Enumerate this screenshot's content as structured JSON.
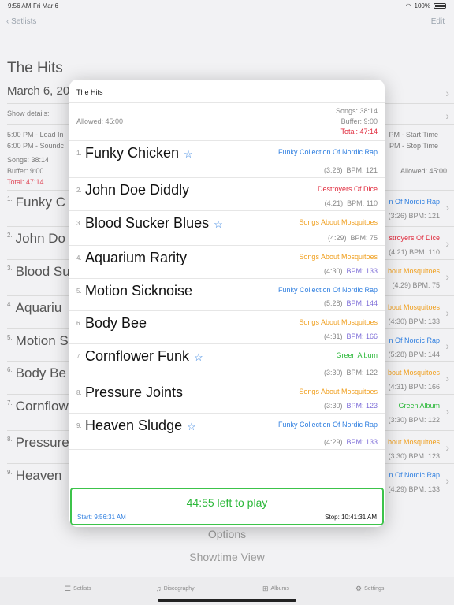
{
  "status": {
    "time": "9:56 AM",
    "date": "Fri Mar 6",
    "battery": "100%"
  },
  "background": {
    "nav": {
      "back": "Setlists",
      "edit": "Edit"
    },
    "title": "The Hits",
    "date": "March 6, 20",
    "show_details": "Show details:",
    "times": {
      "load_in": "5:00 PM - Load In",
      "soundcheck": "6:00 PM - Soundc",
      "start_time": "PM - Start Time",
      "stop_time": "PM - Stop Time"
    },
    "songs_label": "Songs:   38:14",
    "buffer_label": "Buffer:   9:00",
    "total_label": "Total:",
    "total_value": "47:14",
    "allowed": "Allowed:   45:00",
    "songs": [
      {
        "num": "1.",
        "name": "Funky C"
      },
      {
        "num": "2.",
        "name": "John Do"
      },
      {
        "num": "3.",
        "name": "Blood Su"
      },
      {
        "num": "4.",
        "name": "Aquariu"
      },
      {
        "num": "5.",
        "name": "Motion S"
      },
      {
        "num": "6.",
        "name": "Body Be"
      },
      {
        "num": "7.",
        "name": "Cornflow"
      },
      {
        "num": "8.",
        "name": "Pressure"
      },
      {
        "num": "9.",
        "name": "Heaven"
      }
    ],
    "right": [
      {
        "album": "n Of Nordic Rap",
        "album_color": "#2f7fe0",
        "meta": "(3:26)  BPM: 121"
      },
      {
        "album": "stroyers Of Dice",
        "album_color": "#e02a3c",
        "meta": "(4:21)  BPM: 110"
      },
      {
        "album": "bout Mosquitoes",
        "album_color": "#f0a020",
        "meta": "(4:29)  BPM: 75"
      },
      {
        "album": "bout Mosquitoes",
        "album_color": "#f0a020",
        "meta": "(4:30)  BPM: 133"
      },
      {
        "album": "n Of Nordic Rap",
        "album_color": "#2f7fe0",
        "meta": "(5:28)  BPM: 144"
      },
      {
        "album": "bout Mosquitoes",
        "album_color": "#f0a020",
        "meta": "(4:31)  BPM: 166"
      },
      {
        "album": "Green   Album",
        "album_color": "#2cb83a",
        "meta": "(3:30)  BPM: 122"
      },
      {
        "album": "bout Mosquitoes",
        "album_color": "#f0a020",
        "meta": "(3:30)  BPM: 123"
      },
      {
        "album": "n Of Nordic Rap",
        "album_color": "#2f7fe0",
        "meta": "(4:29)  BPM: 133"
      }
    ],
    "options": "Options",
    "showtime": "Showtime View"
  },
  "tabbar": [
    {
      "label": "Setlists",
      "icon": "list-icon"
    },
    {
      "label": "Discography",
      "icon": "music-icon"
    },
    {
      "label": "Albums",
      "icon": "albums-icon"
    },
    {
      "label": "Settings",
      "icon": "gear-icon"
    }
  ],
  "modal": {
    "title": "The Hits",
    "allowed": "Allowed:   45:00",
    "songs_stat": "Songs:   38:14",
    "buffer_stat": "Buffer:   9:00",
    "total_stat": "Total:   47:14",
    "songs": [
      {
        "num": "1.",
        "name": "Funky Chicken",
        "star": true,
        "album": "Funky Collection Of Nordic Rap",
        "album_color": "#2f7fe0",
        "duration": "(3:26)",
        "bpm": "BPM: 121",
        "bpm_color": "#888888"
      },
      {
        "num": "2.",
        "name": "John Doe Diddly",
        "star": false,
        "album": "Destroyers Of Dice",
        "album_color": "#e02a3c",
        "duration": "(4:21)",
        "bpm": "BPM: 110",
        "bpm_color": "#888888"
      },
      {
        "num": "3.",
        "name": "Blood Sucker Blues",
        "star": true,
        "album": "Songs About Mosquitoes",
        "album_color": "#f0a020",
        "duration": "(4:29)",
        "bpm": "BPM: 75",
        "bpm_color": "#888888"
      },
      {
        "num": "4.",
        "name": "Aquarium Rarity",
        "star": false,
        "album": "Songs About Mosquitoes",
        "album_color": "#f0a020",
        "duration": "(4:30)",
        "bpm": "BPM: 133",
        "bpm_color": "#7f6fd8"
      },
      {
        "num": "5.",
        "name": "Motion Sicknoise",
        "star": false,
        "album": "Funky Collection Of Nordic Rap",
        "album_color": "#2f7fe0",
        "duration": "(5:28)",
        "bpm": "BPM: 144",
        "bpm_color": "#7f6fd8"
      },
      {
        "num": "6.",
        "name": "Body Bee",
        "star": false,
        "album": "Songs About Mosquitoes",
        "album_color": "#f0a020",
        "duration": "(4:31)",
        "bpm": "BPM: 166",
        "bpm_color": "#7f6fd8"
      },
      {
        "num": "7.",
        "name": "Cornflower Funk",
        "star": true,
        "album": "Green   Album",
        "album_color": "#2cb83a",
        "duration": "(3:30)",
        "bpm": "BPM: 122",
        "bpm_color": "#888888"
      },
      {
        "num": "8.",
        "name": "Pressure Joints",
        "star": false,
        "album": "Songs About Mosquitoes",
        "album_color": "#f0a020",
        "duration": "(3:30)",
        "bpm": "BPM: 123",
        "bpm_color": "#7f6fd8"
      },
      {
        "num": "9.",
        "name": "Heaven Sludge",
        "star": true,
        "album": "Funky Collection Of Nordic Rap",
        "album_color": "#2f7fe0",
        "duration": "(4:29)",
        "bpm": "BPM: 133",
        "bpm_color": "#7f6fd8"
      }
    ],
    "footer": {
      "time_left": "44:55 left to play",
      "start": "Start: 9:56:31 AM",
      "stop": "Stop: 10:41:31 AM"
    }
  }
}
